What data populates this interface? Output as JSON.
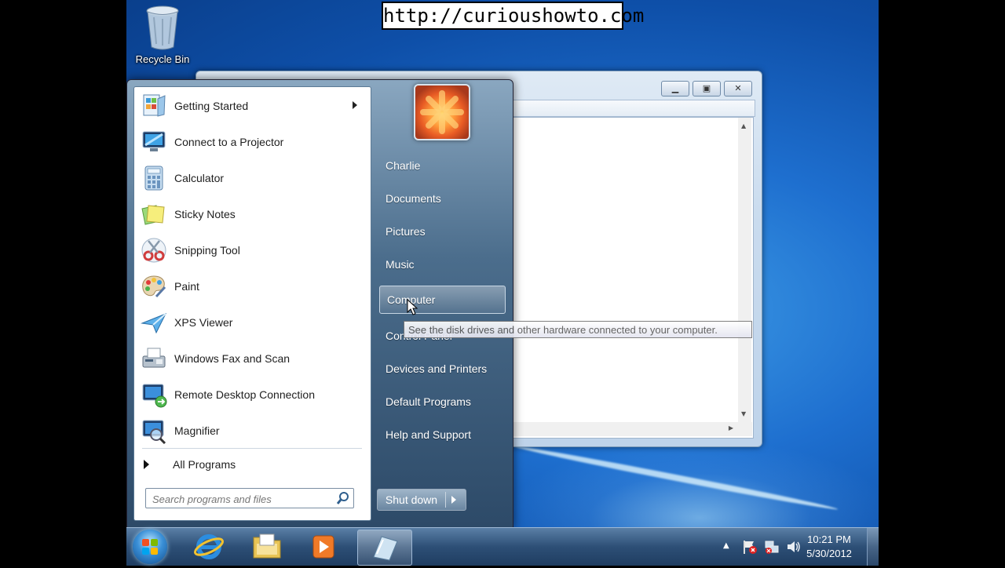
{
  "banner": {
    "url": "http://curioushowto.com"
  },
  "desktop": {
    "recycle_bin_label": "Recycle Bin"
  },
  "start_menu": {
    "programs": [
      {
        "label": "Getting Started",
        "icon": "getting-started-icon",
        "has_submenu": true
      },
      {
        "label": "Connect to a Projector",
        "icon": "projector-icon"
      },
      {
        "label": "Calculator",
        "icon": "calculator-icon"
      },
      {
        "label": "Sticky Notes",
        "icon": "sticky-notes-icon"
      },
      {
        "label": "Snipping Tool",
        "icon": "scissors-icon"
      },
      {
        "label": "Paint",
        "icon": "paint-palette-icon"
      },
      {
        "label": "XPS Viewer",
        "icon": "xps-viewer-icon"
      },
      {
        "label": "Windows Fax and Scan",
        "icon": "fax-icon"
      },
      {
        "label": "Remote Desktop Connection",
        "icon": "remote-desktop-icon"
      },
      {
        "label": "Magnifier",
        "icon": "magnifier-icon"
      }
    ],
    "all_programs_label": "All Programs",
    "search_placeholder": "Search programs and files",
    "right_items": [
      {
        "label": "Charlie"
      },
      {
        "label": "Documents"
      },
      {
        "label": "Pictures"
      },
      {
        "label": "Music"
      },
      {
        "label": "Computer",
        "hovered": true
      },
      {
        "label": "Control Panel"
      },
      {
        "label": "Devices and Printers"
      },
      {
        "label": "Default Programs"
      },
      {
        "label": "Help and Support"
      }
    ],
    "shutdown_label": "Shut down",
    "tooltip": "See the disk drives and other hardware connected to your computer."
  },
  "taskbar": {
    "pinned": [
      {
        "name": "internet-explorer-icon"
      },
      {
        "name": "windows-explorer-icon"
      },
      {
        "name": "media-player-icon"
      },
      {
        "name": "open-window-icon",
        "active": true
      }
    ],
    "tray_icons": [
      "show-hidden-icons-arrow",
      "action-center-flag-icon",
      "network-icon",
      "volume-icon"
    ],
    "time": "10:21 PM",
    "date": "5/30/2012"
  },
  "colors": {
    "desktop_blue": "#1e6fcf",
    "taskbar": "#2d4f76",
    "start_menu_right": "#4b6d8c"
  }
}
